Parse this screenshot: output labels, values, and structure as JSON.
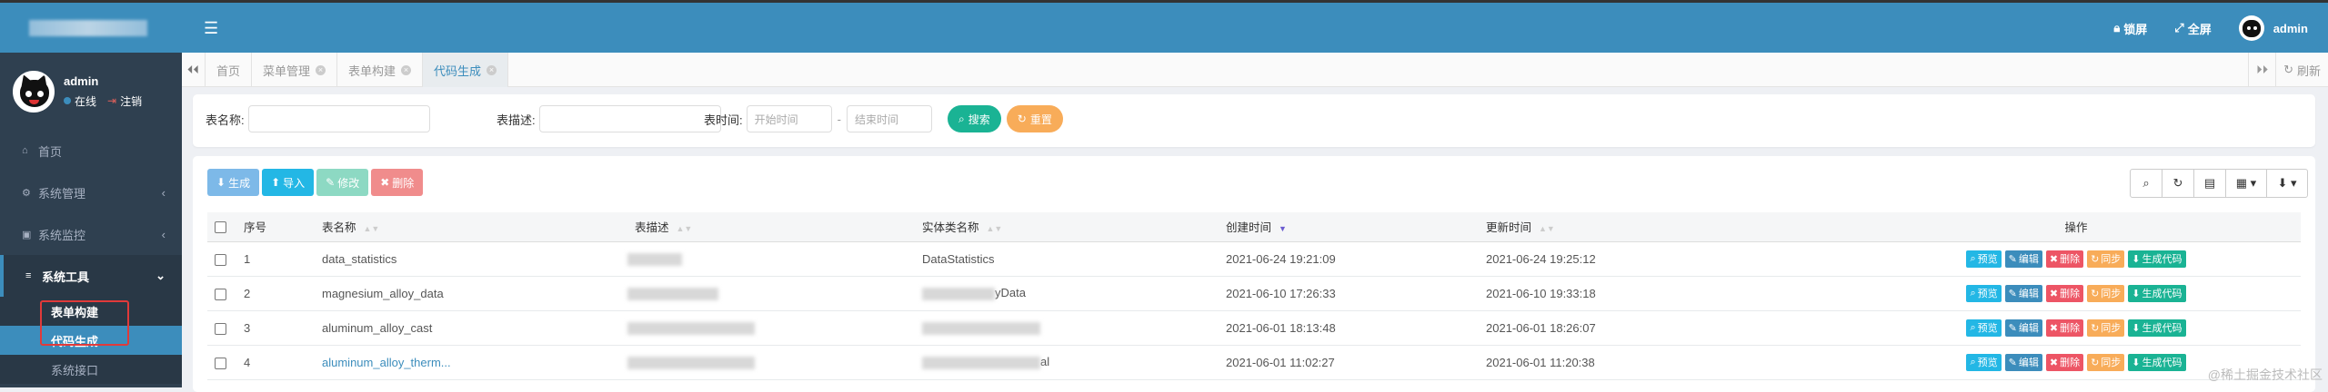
{
  "sidebar": {
    "user": {
      "name": "admin",
      "status": "在线",
      "logout": "注销"
    },
    "menu": [
      {
        "icon": "⌂",
        "label": "首页"
      },
      {
        "icon": "⚙",
        "label": "系统管理",
        "arrow": "‹"
      },
      {
        "icon": "▣",
        "label": "系统监控",
        "arrow": "‹"
      },
      {
        "icon": "≡",
        "label": "系统工具",
        "arrow": "⌄"
      }
    ],
    "submenu": [
      "表单构建",
      "代码生成",
      "系统接口"
    ]
  },
  "header": {
    "lock": "锁屏",
    "fullscreen": "全屏",
    "user": "admin"
  },
  "tabs": {
    "items": [
      {
        "label": "首页",
        "closable": false
      },
      {
        "label": "菜单管理",
        "closable": true
      },
      {
        "label": "表单构建",
        "closable": true
      },
      {
        "label": "代码生成",
        "closable": true,
        "active": true
      }
    ],
    "refresh": "刷新"
  },
  "search": {
    "table_name_label": "表名称:",
    "table_desc_label": "表描述:",
    "time_label": "表时间:",
    "start_placeholder": "开始时间",
    "end_placeholder": "结束时间",
    "dash": "-",
    "search_btn": "搜索",
    "reset_btn": "重置"
  },
  "toolbar": {
    "generate": "生成",
    "import": "导入",
    "edit": "修改",
    "delete": "删除"
  },
  "table": {
    "columns": [
      "序号",
      "表名称",
      "表描述",
      "实体类名称",
      "创建时间",
      "更新时间",
      "操作"
    ],
    "rows": [
      {
        "no": "1",
        "name": "data_statistics",
        "desc": "",
        "entity": "DataStatistics",
        "entity_suffix": "",
        "created": "2021-06-24 19:21:09",
        "updated": "2021-06-24 19:25:12"
      },
      {
        "no": "2",
        "name": "magnesium_alloy_data",
        "desc": "",
        "entity": "",
        "entity_suffix": "yData",
        "created": "2021-06-10 17:26:33",
        "updated": "2021-06-10 19:33:18"
      },
      {
        "no": "3",
        "name": "aluminum_alloy_cast",
        "desc": "",
        "entity": "",
        "entity_suffix": "",
        "created": "2021-06-01 18:13:48",
        "updated": "2021-06-01 18:26:07"
      },
      {
        "no": "4",
        "name": "aluminum_alloy_therm...",
        "desc": "",
        "entity": "",
        "entity_suffix": "al",
        "created": "2021-06-01 11:02:27",
        "updated": "2021-06-01 11:20:38"
      }
    ],
    "ops": {
      "preview": "预览",
      "edit": "编辑",
      "delete": "删除",
      "sync": "同步",
      "gen": "生成代码"
    }
  },
  "watermark": "@稀土掘金技术社区"
}
